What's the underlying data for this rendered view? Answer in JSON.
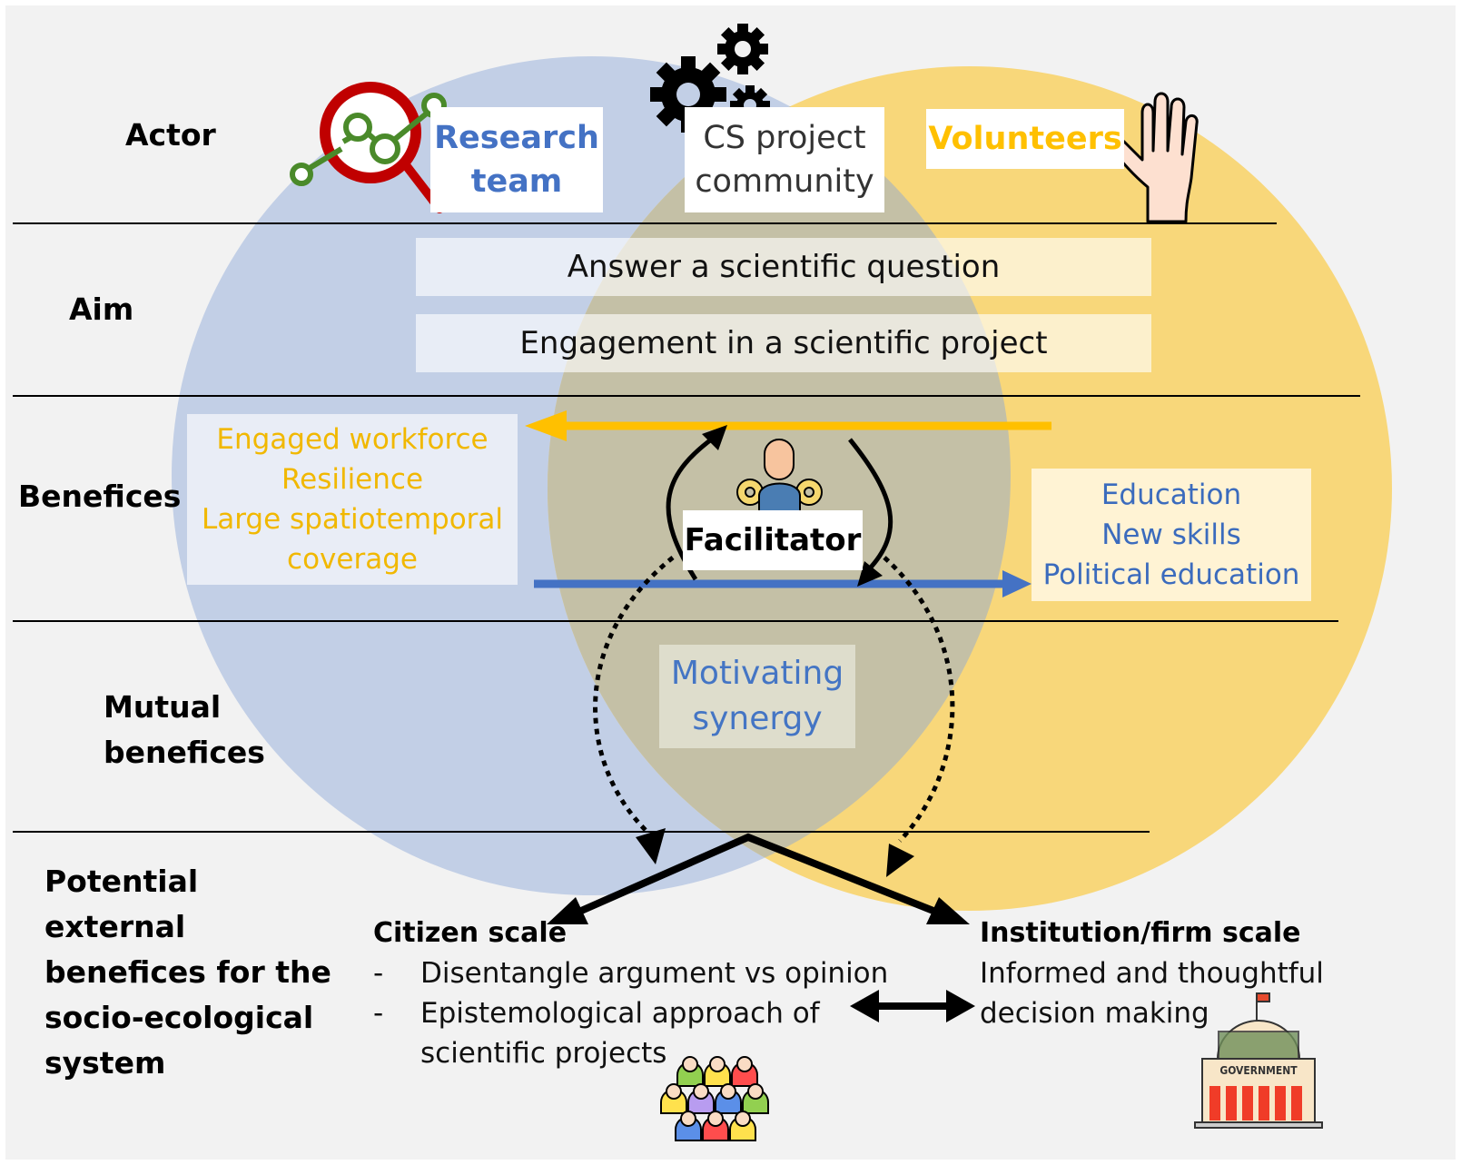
{
  "colors": {
    "research_blue": "#4472c4",
    "volunteer_yellow": "#ffc000",
    "circle_left": "#c2cfe6",
    "circle_right": "#f8d77a",
    "overlap": "#c4c0a6",
    "background": "#f2f2f2"
  },
  "rows": {
    "actor": "Actor",
    "aim": "Aim",
    "benefits": "Benefices",
    "mutual": [
      "Mutual",
      "benefices"
    ],
    "external": [
      "Potential",
      "external",
      "benefices for the",
      "socio-ecological",
      "system"
    ]
  },
  "actors": {
    "research": [
      "Research",
      "team"
    ],
    "community": [
      "CS project",
      "community"
    ],
    "volunteers": "Volunteers"
  },
  "aims": [
    "Answer a scientific question",
    "Engagement in a scientific project"
  ],
  "benefits": {
    "to_research": [
      "Engaged workforce",
      "Resilience",
      "Large spatiotemporal",
      "coverage"
    ],
    "to_volunteers": [
      "Education",
      "New skills",
      "Political education"
    ],
    "facilitator": "Facilitator"
  },
  "mutual": [
    "Motivating",
    "synergy"
  ],
  "external": {
    "citizen": {
      "title": "Citizen scale",
      "items": [
        {
          "bullet": "-",
          "text": "Disentangle argument vs opinion"
        },
        {
          "bullet": "-",
          "text": "Epistemological approach of"
        },
        {
          "bullet": "",
          "text": "scientific projects"
        }
      ]
    },
    "institution": {
      "title": "Institution/firm scale",
      "lines": [
        "Informed and thoughtful",
        "decision making"
      ]
    },
    "government_sign": "GOVERNMENT"
  },
  "icons": {
    "research": "magnifier-molecule-icon",
    "community": "gears-icon",
    "volunteers": "raised-hand-icon",
    "facilitator": "person-gears-icon",
    "citizens": "crowd-icon",
    "institution": "government-building-icon"
  }
}
